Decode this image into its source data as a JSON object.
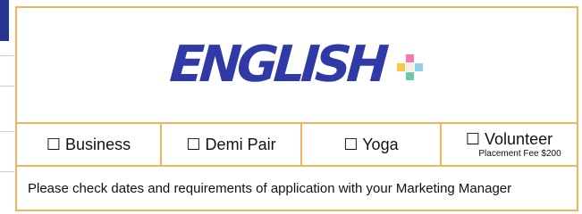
{
  "logo": {
    "text": "ENGLISH",
    "icon": "plus-icon",
    "colors": {
      "text": "#2f3aa6",
      "plus_top": "#f27ab3",
      "plus_left": "#f7c84c",
      "plus_right": "#8fd3e8",
      "plus_bottom": "#6cc8b1"
    }
  },
  "options": [
    {
      "label": "☐ Business"
    },
    {
      "label": "☐ Demi Pair"
    },
    {
      "label": "☐ Yoga"
    },
    {
      "label": "☐ Volunteer",
      "note": "Placement Fee $200"
    }
  ],
  "notice": "Please check dates and requirements of application with your Marketing Manager",
  "colors": {
    "border": "#f2b35a",
    "left_tab": "#26358f"
  }
}
